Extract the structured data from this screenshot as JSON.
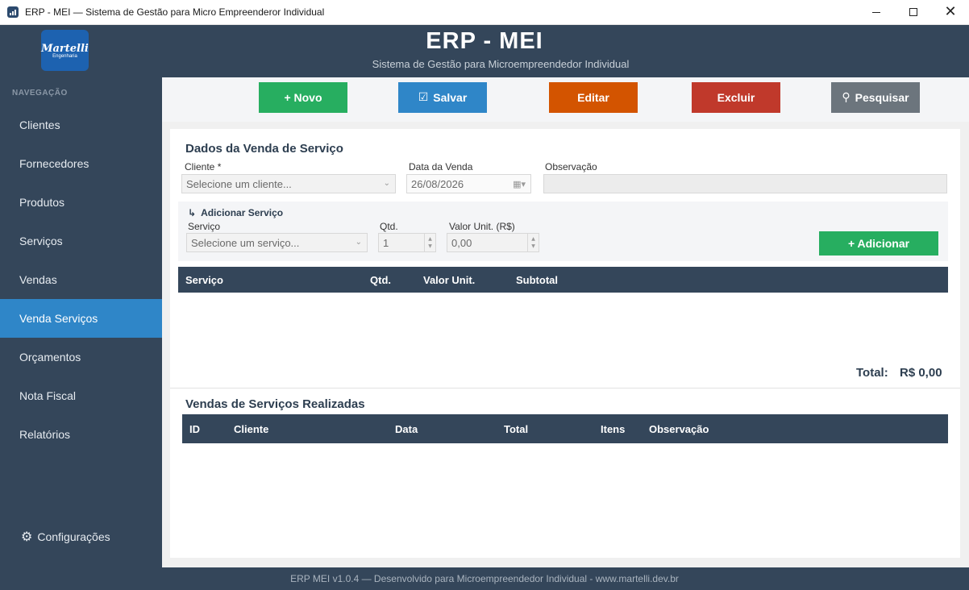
{
  "window": {
    "title": "ERP - MEI — Sistema de Gestão para Micro Empreenderor Individual",
    "minimize": "",
    "maximize": "",
    "close": "✕"
  },
  "header": {
    "logo_line1": "Martelli",
    "logo_line2": "Engenharia",
    "title": "ERP - MEI",
    "subtitle": "Sistema de Gestão para Microempreendedor Individual"
  },
  "sidebar": {
    "section_label": "NAVEGAÇÃO",
    "items": [
      {
        "label": "Clientes"
      },
      {
        "label": "Fornecedores"
      },
      {
        "label": "Produtos"
      },
      {
        "label": "Serviços"
      },
      {
        "label": "Vendas"
      },
      {
        "label": "Venda Serviços",
        "active": true
      },
      {
        "label": "Orçamentos"
      },
      {
        "label": "Nota Fiscal"
      },
      {
        "label": "Relatórios"
      }
    ],
    "settings_label": "Configurações"
  },
  "toolbar": {
    "new_label": "+ Novo",
    "save_label": "Salvar",
    "edit_label": "Editar",
    "delete_label": "Excluir",
    "search_label": "Pesquisar",
    "colors": {
      "new": "#27ae60",
      "save": "#2f86c8",
      "edit": "#d35400",
      "delete": "#c0392b",
      "search": "#6c757d"
    }
  },
  "form": {
    "section_title": "Dados da Venda de Serviço",
    "client_label": "Cliente *",
    "client_placeholder": "Selecione um cliente...",
    "date_label": "Data da Venda",
    "date_value": "26/08/2026",
    "notes_label": "Observação",
    "notes_value": ""
  },
  "add_service": {
    "title": "Adicionar Serviço",
    "service_label": "Serviço",
    "service_placeholder": "Selecione um serviço...",
    "qty_label": "Qtd.",
    "qty_value": "1",
    "unit_label": "Valor Unit. (R$)",
    "unit_value": "0,00",
    "add_button": "+ Adicionar"
  },
  "items_table": {
    "columns": [
      "Serviço",
      "Qtd.",
      "Valor Unit.",
      "Subtotal"
    ],
    "rows": []
  },
  "totals": {
    "label": "Total:",
    "value": "R$ 0,00"
  },
  "sales_table": {
    "title": "Vendas de Serviços Realizadas",
    "columns": [
      "ID",
      "Cliente",
      "Data",
      "Total",
      "Itens",
      "Observação"
    ],
    "rows": []
  },
  "footer": {
    "text": "ERP MEI v1.0.4  —  Desenvolvido para Microempreendedor Individual  -  www.martelli.dev.br"
  }
}
